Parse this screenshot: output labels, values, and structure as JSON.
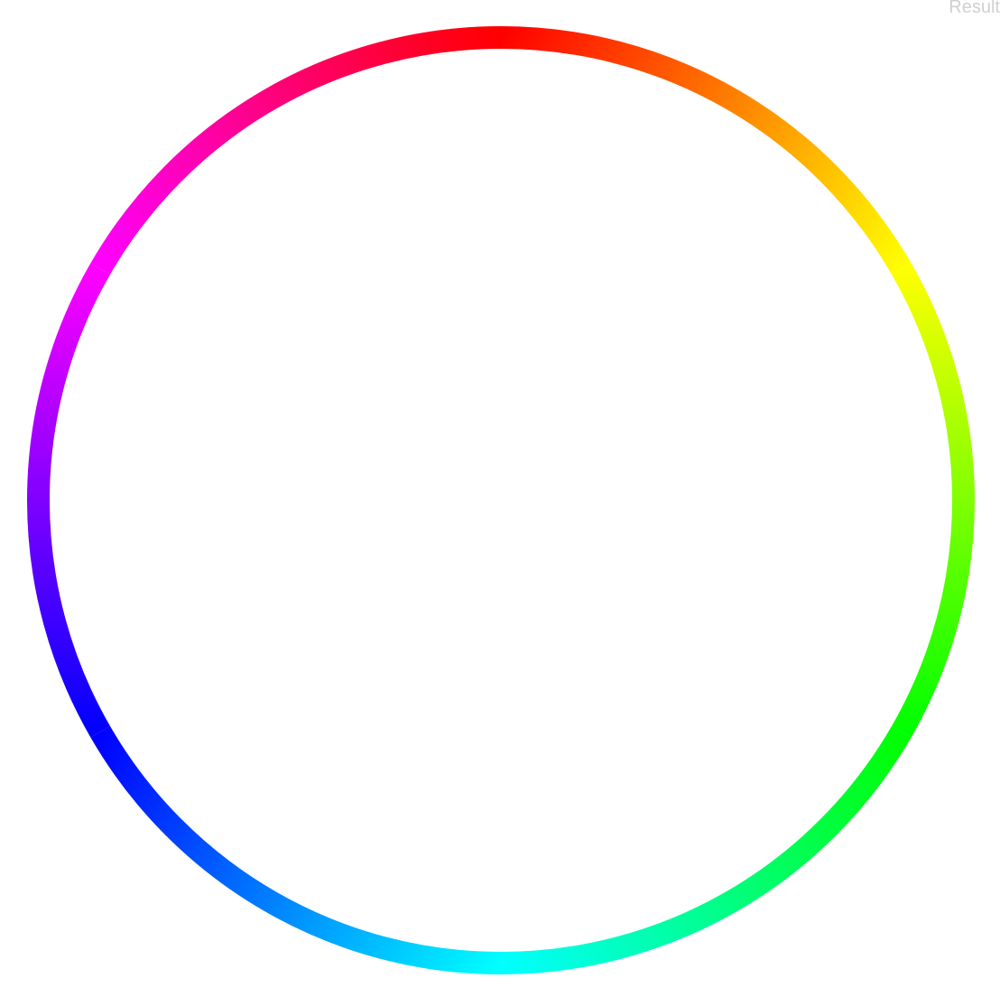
{
  "label": "Result",
  "wheel": {
    "stops": [
      "#ff0000",
      "#ffff00",
      "#00ff00",
      "#00ffff",
      "#0000ff",
      "#ff00ff",
      "#ff0000"
    ]
  }
}
